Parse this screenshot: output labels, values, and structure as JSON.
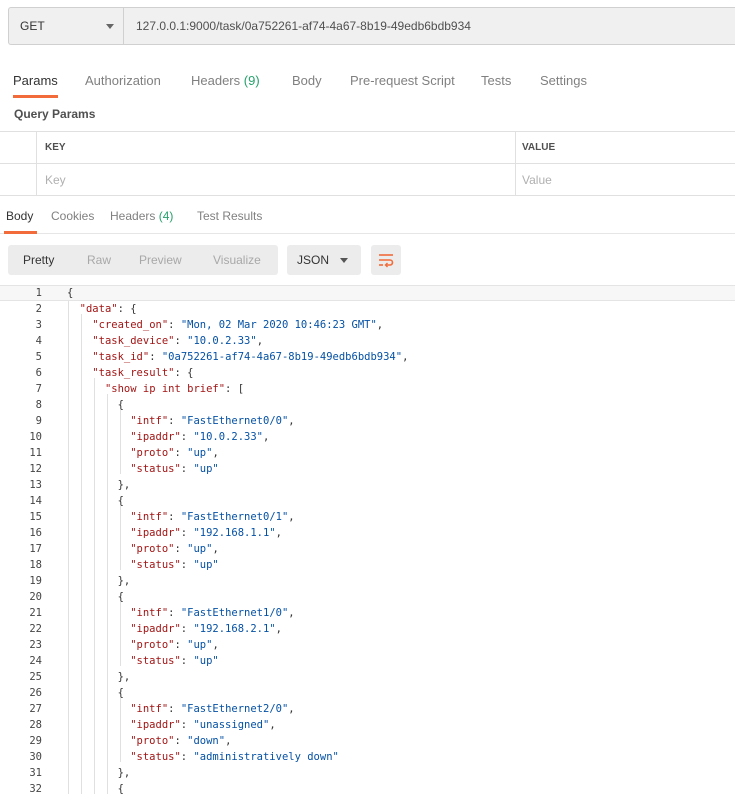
{
  "request": {
    "method": "GET",
    "url": "127.0.0.1:9000/task/0a752261-af74-4a67-8b19-49edb6bdb934"
  },
  "request_tabs": [
    {
      "label": "Params",
      "count": "",
      "active": true
    },
    {
      "label": "Authorization",
      "count": "",
      "active": false
    },
    {
      "label": "Headers",
      "count": "(9)",
      "active": false
    },
    {
      "label": "Body",
      "count": "",
      "active": false
    },
    {
      "label": "Pre-request Script",
      "count": "",
      "active": false
    },
    {
      "label": "Tests",
      "count": "",
      "active": false
    },
    {
      "label": "Settings",
      "count": "",
      "active": false
    }
  ],
  "query_params": {
    "title": "Query Params",
    "key_header": "KEY",
    "value_header": "VALUE",
    "key_placeholder": "Key",
    "value_placeholder": "Value"
  },
  "response_tabs": [
    {
      "label": "Body",
      "count": "",
      "active": true
    },
    {
      "label": "Cookies",
      "count": "",
      "active": false
    },
    {
      "label": "Headers",
      "count": "(4)",
      "active": false
    },
    {
      "label": "Test Results",
      "count": "",
      "active": false
    }
  ],
  "view_modes": [
    "Pretty",
    "Raw",
    "Preview",
    "Visualize"
  ],
  "active_view": "Pretty",
  "format": "JSON",
  "icons": {
    "dropdown": "chevron-down-icon",
    "wrap": "wrap-lines-icon"
  },
  "colors": {
    "accent": "#f26b3a",
    "count": "#26a06b",
    "key": "#a31515",
    "string": "#0451a5"
  },
  "code_lines": [
    {
      "n": "1",
      "t": "{"
    },
    {
      "n": "2",
      "t": "  \"data\": {"
    },
    {
      "n": "3",
      "t": "    \"created_on\": \"Mon, 02 Mar 2020 10:46:23 GMT\","
    },
    {
      "n": "4",
      "t": "    \"task_device\": \"10.0.2.33\","
    },
    {
      "n": "5",
      "t": "    \"task_id\": \"0a752261-af74-4a67-8b19-49edb6bdb934\","
    },
    {
      "n": "6",
      "t": "    \"task_result\": {"
    },
    {
      "n": "7",
      "t": "      \"show ip int brief\": ["
    },
    {
      "n": "8",
      "t": "        {"
    },
    {
      "n": "9",
      "t": "          \"intf\": \"FastEthernet0/0\","
    },
    {
      "n": "10",
      "t": "          \"ipaddr\": \"10.0.2.33\","
    },
    {
      "n": "11",
      "t": "          \"proto\": \"up\","
    },
    {
      "n": "12",
      "t": "          \"status\": \"up\""
    },
    {
      "n": "13",
      "t": "        },"
    },
    {
      "n": "14",
      "t": "        {"
    },
    {
      "n": "15",
      "t": "          \"intf\": \"FastEthernet0/1\","
    },
    {
      "n": "16",
      "t": "          \"ipaddr\": \"192.168.1.1\","
    },
    {
      "n": "17",
      "t": "          \"proto\": \"up\","
    },
    {
      "n": "18",
      "t": "          \"status\": \"up\""
    },
    {
      "n": "19",
      "t": "        },"
    },
    {
      "n": "20",
      "t": "        {"
    },
    {
      "n": "21",
      "t": "          \"intf\": \"FastEthernet1/0\","
    },
    {
      "n": "22",
      "t": "          \"ipaddr\": \"192.168.2.1\","
    },
    {
      "n": "23",
      "t": "          \"proto\": \"up\","
    },
    {
      "n": "24",
      "t": "          \"status\": \"up\""
    },
    {
      "n": "25",
      "t": "        },"
    },
    {
      "n": "26",
      "t": "        {"
    },
    {
      "n": "27",
      "t": "          \"intf\": \"FastEthernet2/0\","
    },
    {
      "n": "28",
      "t": "          \"ipaddr\": \"unassigned\","
    },
    {
      "n": "29",
      "t": "          \"proto\": \"down\","
    },
    {
      "n": "30",
      "t": "          \"status\": \"administratively down\""
    },
    {
      "n": "31",
      "t": "        },"
    },
    {
      "n": "32",
      "t": "        {"
    }
  ]
}
